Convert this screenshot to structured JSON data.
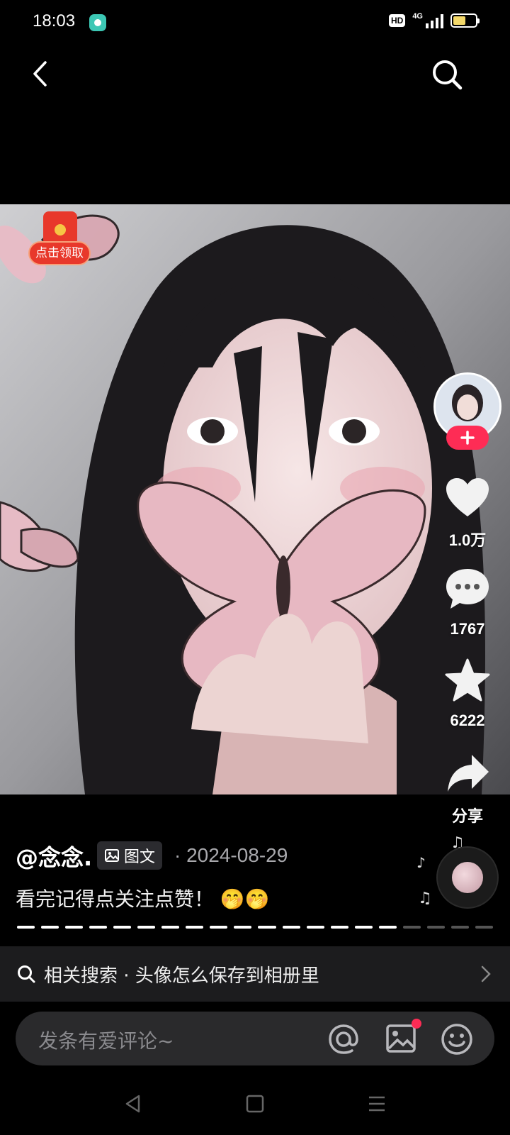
{
  "status_bar": {
    "time": "18:03",
    "hd": "HD",
    "network": "4G",
    "battery_level": 0.55
  },
  "header": {
    "back_icon": "chevron-left-icon",
    "search_icon": "search-icon"
  },
  "red_packet": {
    "label": "点击领取"
  },
  "actions": {
    "follow_icon": "plus-icon",
    "like_count": "1.0万",
    "comment_count": "1767",
    "favorite_count": "6222",
    "share_label": "分享"
  },
  "post": {
    "author": "@念念.",
    "type_tag": "图文",
    "date": "· 2024-08-29",
    "caption": "看完记得点关注点赞！ 🤭🤭"
  },
  "slides": {
    "total": 20,
    "current": 16
  },
  "related": {
    "text": "相关搜索 · 头像怎么保存到相册里"
  },
  "comment": {
    "placeholder": "发条有爱评论~"
  },
  "colors": {
    "accent": "#fe2c55",
    "background": "#000000"
  }
}
